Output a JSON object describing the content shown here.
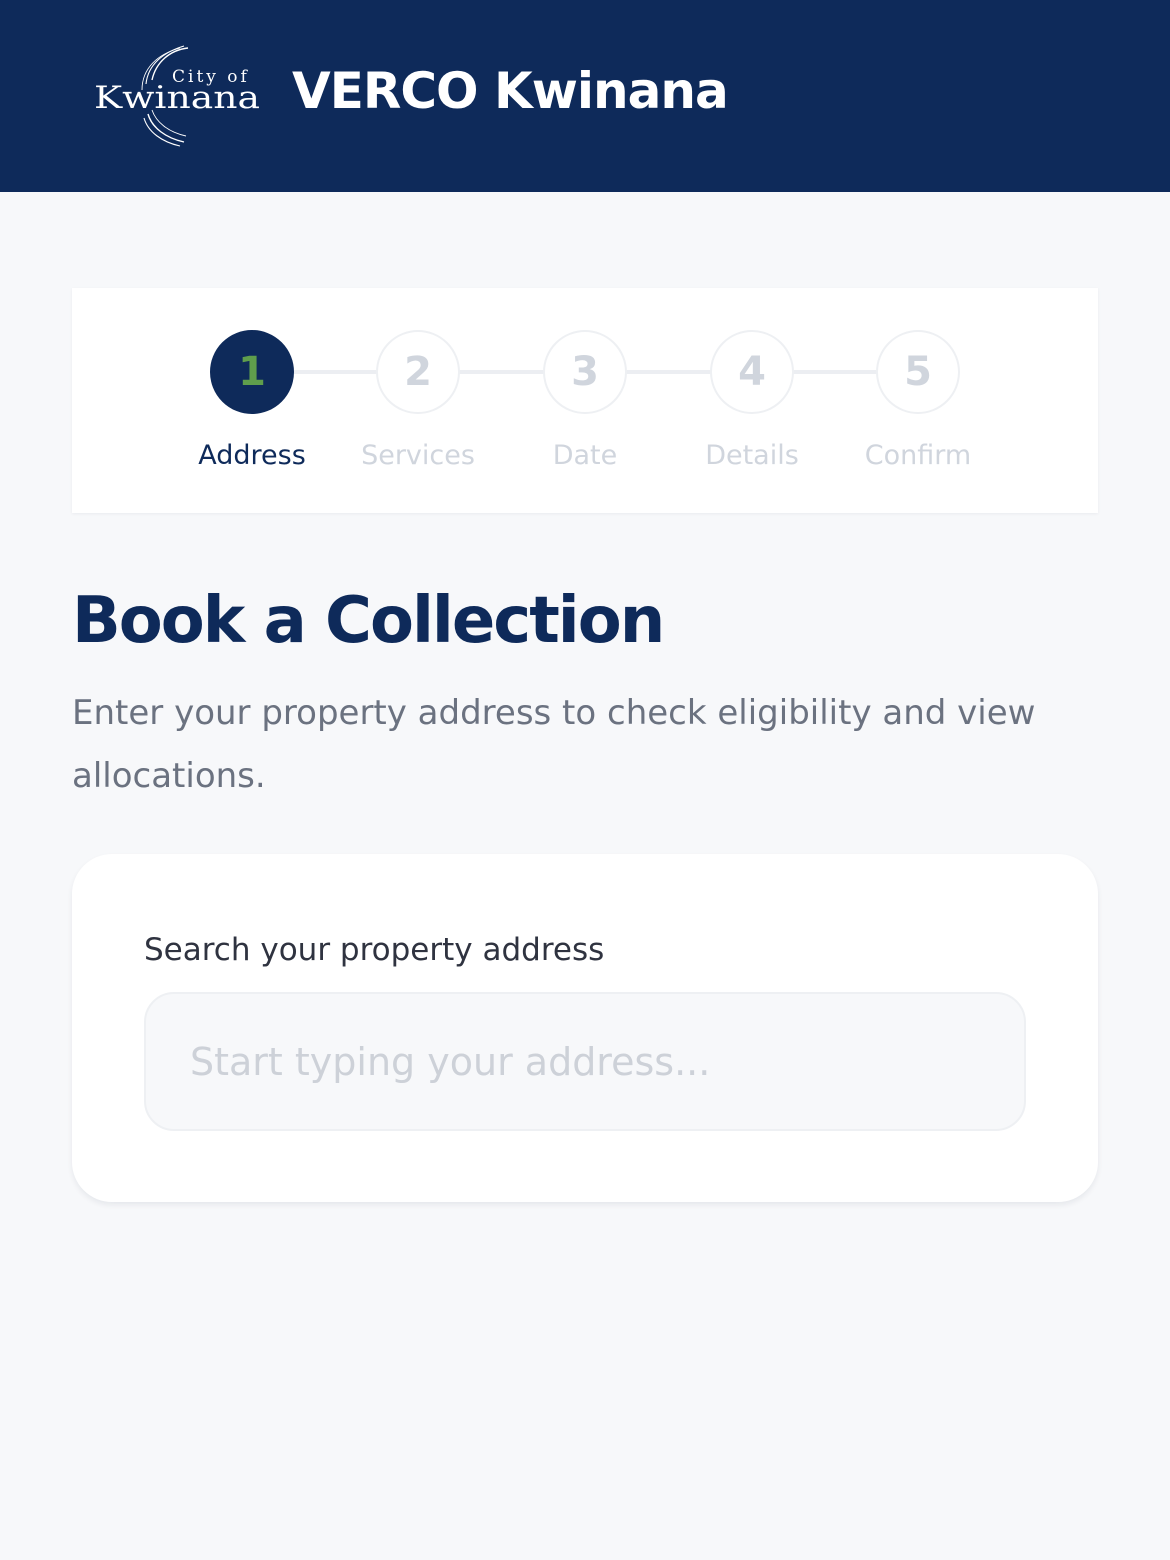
{
  "header": {
    "logo": {
      "line1": "City of",
      "line2": "Kwinana",
      "icon": "city-of-kwinana-logo"
    },
    "title": "VERCO Kwinana"
  },
  "stepper": {
    "steps": [
      {
        "number": "1",
        "label": "Address",
        "active": true
      },
      {
        "number": "2",
        "label": "Services",
        "active": false
      },
      {
        "number": "3",
        "label": "Date",
        "active": false
      },
      {
        "number": "4",
        "label": "Details",
        "active": false
      },
      {
        "number": "5",
        "label": "Confirm",
        "active": false
      }
    ]
  },
  "main": {
    "title": "Book a Collection",
    "subtitle": "Enter your property address to check eligibility and view allocations."
  },
  "search": {
    "label": "Search your property address",
    "value": "",
    "placeholder": "Start typing your address..."
  },
  "colors": {
    "brand_navy": "#0e2a5a",
    "active_step_number": "#5f9e4c",
    "inactive": "#d0d5dd",
    "background": "#f7f8fa",
    "muted_text": "#6b7280"
  }
}
